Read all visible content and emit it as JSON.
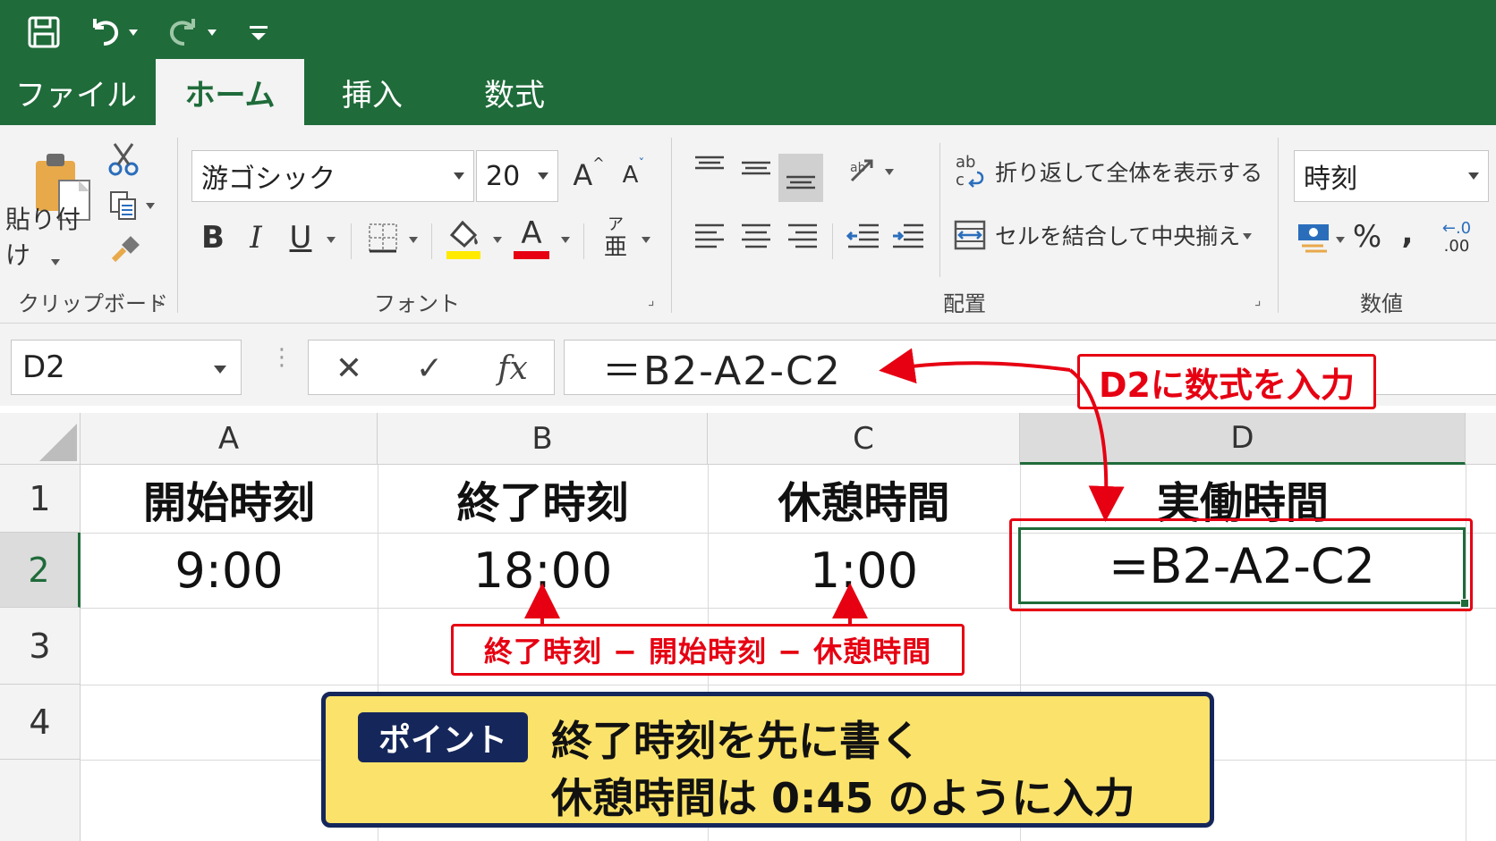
{
  "ribbon_tabs": [
    {
      "label": "ファイル",
      "active": false
    },
    {
      "label": "ホーム",
      "active": true
    },
    {
      "label": "挿入",
      "active": false
    },
    {
      "label": "数式",
      "active": false
    }
  ],
  "quick_access": [
    "save-icon",
    "undo-icon",
    "redo-icon",
    "customize-icon"
  ],
  "clipboard": {
    "paste_label": "貼り付け",
    "group_label": "クリップボード"
  },
  "font": {
    "name": "游ゴシック",
    "size": "20",
    "bold": "B",
    "italic": "I",
    "underline": "U",
    "font_color_glyph": "A",
    "grow_glyph": "A",
    "shrink_glyph": "A",
    "phonetic_top": "ア",
    "phonetic_bottom": "亜",
    "group_label": "フォント"
  },
  "alignment": {
    "wrap_text": "折り返して全体を表示する",
    "merge_center": "セルを結合して中央揃え",
    "group_label": "配置"
  },
  "number": {
    "format": "時刻",
    "percent": "%",
    "comma": ",",
    "decimal_top": "←.0",
    "decimal_bottom": ".00",
    "group_label": "数値"
  },
  "formula_bar": {
    "name_box": "D2",
    "cancel": "✕",
    "enter": "✓",
    "fx": "fx",
    "formula": "＝B2-A2-C2"
  },
  "columns": [
    "A",
    "B",
    "C",
    "D"
  ],
  "rows": [
    "1",
    "2",
    "3",
    "4"
  ],
  "cells": {
    "A1": "開始時刻",
    "B1": "終了時刻",
    "C1": "休憩時間",
    "D1": "実働時間",
    "A2": "9:00",
    "B2": "18:00",
    "C2": "1:00",
    "D2": "=B2-A2-C2"
  },
  "annotations": {
    "d2_note": "D2に数式を入力",
    "calc_note": "終了時刻 − 開始時刻 − 休憩時間",
    "point_tag": "ポイント",
    "point_line1": "終了時刻を先に書く",
    "point_line2": "休憩時間は 0:45 のように入力"
  },
  "colors": {
    "excel_green": "#1f6b3a",
    "annotation_red": "#e60012",
    "point_yellow": "#fbe36b",
    "point_navy": "#15275a"
  }
}
